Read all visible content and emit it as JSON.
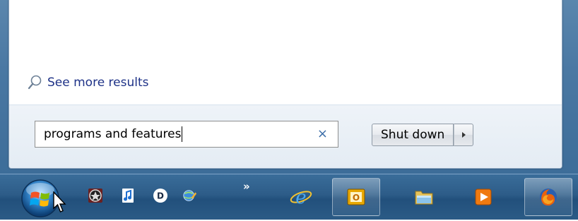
{
  "start_menu": {
    "see_more_label": "See more results",
    "search_value": "programs and features",
    "clear_glyph": "×",
    "shutdown_label": "Shut down"
  },
  "taskbar": {
    "overflow_glyph": "»",
    "quick_launch": [
      "steering-wheel-icon",
      "music-note-icon",
      "d-app-icon",
      "network-globe-icon"
    ],
    "buttons": [
      "internet-explorer-icon",
      "outlook-icon",
      "file-explorer-icon",
      "media-player-icon",
      "firefox-icon"
    ]
  },
  "colors": {
    "link": "#1e3287",
    "frame": "#4a78a3",
    "taskbar": "#2d5c88"
  }
}
